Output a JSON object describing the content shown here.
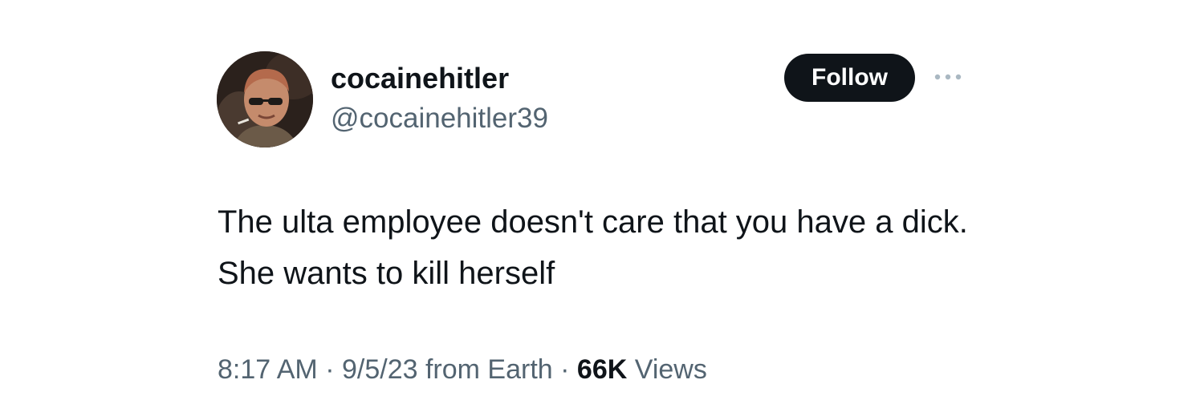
{
  "author": {
    "display_name": "cocainehitler",
    "handle": "@cocainehitler39",
    "avatar_icon": "profile-photo"
  },
  "actions": {
    "follow_label": "Follow",
    "more_icon": "ellipsis-icon"
  },
  "tweet": {
    "text": "The ulta employee doesn't care that you have a dick. She wants to kill herself"
  },
  "meta": {
    "time": "8:17 AM",
    "date": "9/5/23",
    "source": "from Earth",
    "separator": "·",
    "views_count": "66K",
    "views_label": "Views"
  },
  "colors": {
    "text_primary": "#0f1419",
    "text_secondary": "#536471",
    "follow_bg": "#0f1419",
    "follow_text": "#ffffff",
    "more_dots": "#aab8c2"
  }
}
